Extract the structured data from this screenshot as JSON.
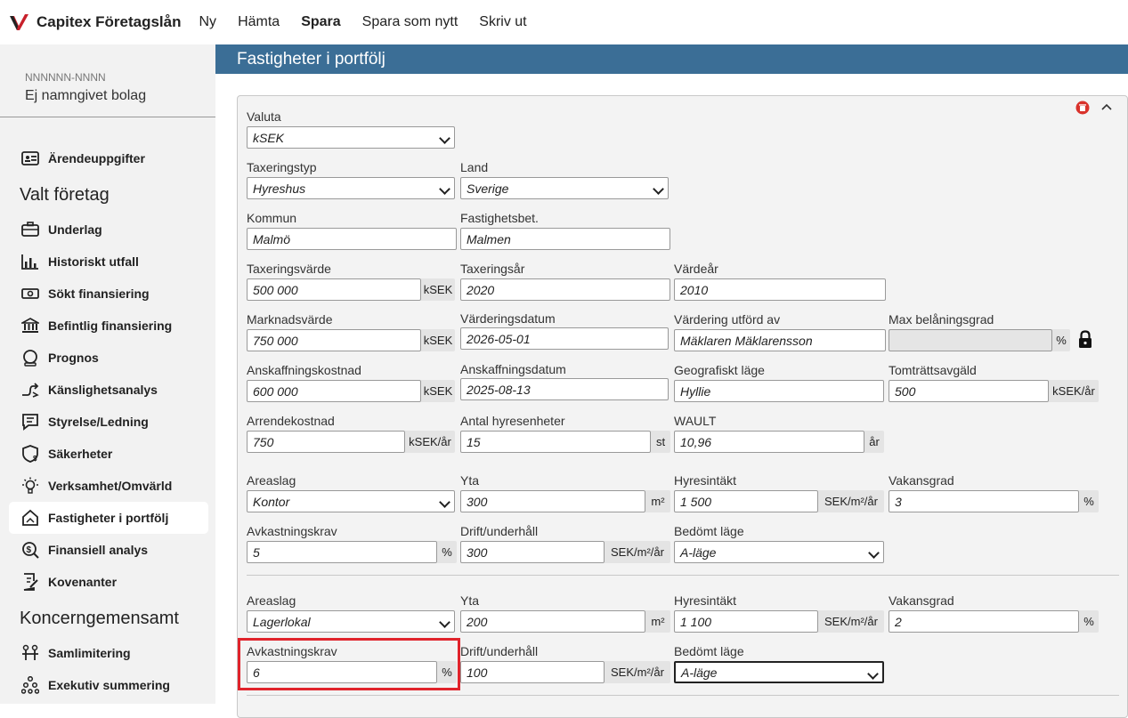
{
  "app": {
    "title": "Capitex Företagslån"
  },
  "topnav": {
    "new": "Ny",
    "fetch": "Hämta",
    "save": "Spara",
    "save_as_new": "Spara som nytt",
    "print": "Skriv ut"
  },
  "company": {
    "orgnr": "NNNNNN-NNNN",
    "name": "Ej namngivet bolag"
  },
  "sidebar": {
    "case_details": "Ärendeuppgifter",
    "section_selected": "Valt företag",
    "items": [
      "Underlag",
      "Historiskt utfall",
      "Sökt finansiering",
      "Befintlig finansiering",
      "Prognos",
      "Känslighetsanalys",
      "Styrelse/Ledning",
      "Säkerheter",
      "Verksamhet/Omvärld",
      "Fastigheter i portfölj",
      "Finansiell analys",
      "Kovenanter"
    ],
    "section_group": "Koncerngemensamt",
    "group_items": [
      "Samlimitering",
      "Exekutiv summering"
    ]
  },
  "main": {
    "title": "Fastigheter i portfölj"
  },
  "form": {
    "valuta_label": "Valuta",
    "valuta": "kSEK",
    "taxeringstyp_label": "Taxeringstyp",
    "taxeringstyp": "Hyreshus",
    "land_label": "Land",
    "land": "Sverige",
    "kommun_label": "Kommun",
    "kommun": "Malmö",
    "fastbet_label": "Fastighetsbet.",
    "fastbet": "Malmen",
    "taxvarde_label": "Taxeringsvärde",
    "taxvarde": "500 000",
    "taxvarde_unit": "kSEK",
    "taxar_label": "Taxeringsår",
    "taxar": "2020",
    "vardear_label": "Värdeår",
    "vardear": "2010",
    "marknad_label": "Marknadsvärde",
    "marknad": "750 000",
    "marknad_unit": "kSEK",
    "vdatum_label": "Värderingsdatum",
    "vdatum": "2026-05-01",
    "vutford_label": "Värdering utförd av",
    "vutford": "Mäklaren Mäklarensson",
    "maxbel_label": "Max belåningsgrad",
    "maxbel": "",
    "maxbel_unit": "%",
    "anskost_label": "Anskaffningskostnad",
    "anskost": "600 000",
    "anskost_unit": "kSEK",
    "ansdatum_label": "Anskaffningsdatum",
    "ansdatum": "2025-08-13",
    "geo_label": "Geografiskt läge",
    "geo": "Hyllie",
    "tomt_label": "Tomträttsavgäld",
    "tomt": "500",
    "tomt_unit": "kSEK/år",
    "arrende_label": "Arrendekostnad",
    "arrende": "750",
    "arrende_unit": "kSEK/år",
    "hyresenh_label": "Antal hyresenheter",
    "hyresenh": "15",
    "hyresenh_unit": "st",
    "wault_label": "WAULT",
    "wault": "10,96",
    "wault_unit": "år"
  },
  "areas": [
    {
      "areaslag_label": "Areaslag",
      "areaslag": "Kontor",
      "yta_label": "Yta",
      "yta": "300",
      "yta_unit": "m²",
      "hyra_label": "Hyresintäkt",
      "hyra": "1 500",
      "hyra_unit": "SEK/m²/år",
      "vakans_label": "Vakansgrad",
      "vakans": "3",
      "vakans_unit": "%",
      "avk_label": "Avkastningskrav",
      "avk": "5",
      "avk_unit": "%",
      "drift_label": "Drift/underhåll",
      "drift": "300",
      "drift_unit": "SEK/m²/år",
      "lage_label": "Bedömt läge",
      "lage": "A-läge"
    },
    {
      "areaslag_label": "Areaslag",
      "areaslag": "Lagerlokal",
      "yta_label": "Yta",
      "yta": "200",
      "yta_unit": "m²",
      "hyra_label": "Hyresintäkt",
      "hyra": "1 100",
      "hyra_unit": "SEK/m²/år",
      "vakans_label": "Vakansgrad",
      "vakans": "2",
      "vakans_unit": "%",
      "avk_label": "Avkastningskrav",
      "avk": "6",
      "avk_unit": "%",
      "drift_label": "Drift/underhåll",
      "drift": "100",
      "drift_unit": "SEK/m²/år",
      "lage_label": "Bedömt läge",
      "lage": "A-läge"
    }
  ],
  "colors": {
    "header": "#3b6e96",
    "highlight": "#e0232b",
    "brand": "#c8202b"
  }
}
